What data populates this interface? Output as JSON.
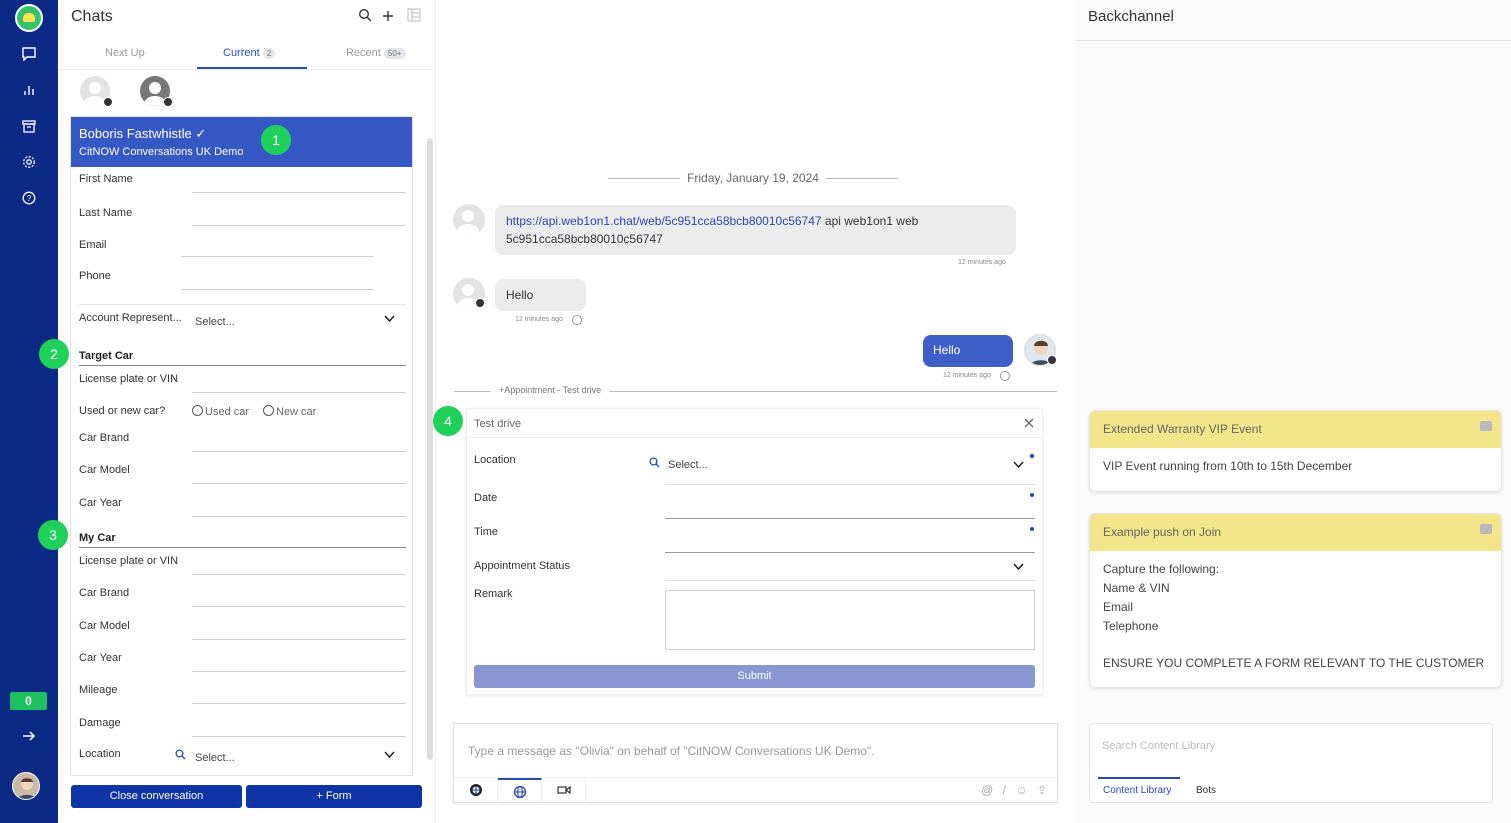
{
  "nav": {
    "unread_badge": "0",
    "icons": [
      "chat-icon",
      "bar-chart-icon",
      "archive-icon",
      "settings-icon",
      "help-icon",
      "arrow-right-icon"
    ]
  },
  "chats": {
    "title": "Chats",
    "tabs": [
      {
        "label": "Next Up",
        "count": ""
      },
      {
        "label": "Current",
        "count": "2"
      },
      {
        "label": "Recent",
        "count": "50+"
      }
    ]
  },
  "contact": {
    "name": "Boboris Fastwhistle",
    "check": "✓",
    "org": "CitNOW Conversations UK Demo",
    "fields": {
      "first_name": "First Name",
      "last_name": "Last Name",
      "email": "Email",
      "phone": "Phone",
      "account_rep": "Account Represent...",
      "account_rep_value": "Select..."
    },
    "target_car": {
      "title": "Target Car",
      "plate": "License plate or VIN",
      "used_or_new": "Used or new car?",
      "used": "Used car",
      "new": "New car",
      "brand": "Car Brand",
      "model": "Car Model",
      "year": "Car Year"
    },
    "my_car": {
      "title": "My Car",
      "plate": "License plate or VIN",
      "brand": "Car Brand",
      "model": "Car Model",
      "year": "Car Year",
      "mileage": "Mileage",
      "damage": "Damage",
      "location": "Location",
      "location_value": "Select..."
    },
    "close_button": "Close conversation",
    "form_button": "+ Form"
  },
  "markers": [
    "1",
    "2",
    "3",
    "4"
  ],
  "conversation": {
    "date": "Friday, January 19, 2024",
    "messages": [
      {
        "link": "https://api.web1on1.chat/web/5c951cca58bcb80010c56747",
        "text_a": " api web1on1 web",
        "text_b": "5c951cca58bcb80010c56747",
        "time": "12 minutes ago"
      },
      {
        "text": "Hello",
        "time": "12 minutes ago"
      },
      {
        "text": "Hello",
        "time": "12 minutes ago"
      }
    ],
    "appointment_divider": "+Appointment - Test drive"
  },
  "appointment_form": {
    "title": "Test drive",
    "location": "Location",
    "location_value": "Select...",
    "date": "Date",
    "time": "Time",
    "status": "Appointment Status",
    "remark": "Remark",
    "submit": "Submit"
  },
  "composer": {
    "placeholder": "Type a message as \"Olivia\"  on behalf of \"CitNOW Conversations UK Demo\"."
  },
  "backchannel": {
    "title": "Backchannel",
    "notes": [
      {
        "title": "Extended Warranty VIP Event",
        "lines": [
          "VIP Event running from 10th to 15th December"
        ]
      },
      {
        "title": "Example push on Join",
        "lines": [
          "Capture the following:",
          "Name & VIN",
          "Email",
          "Telephone",
          "",
          "ENSURE YOU COMPLETE A FORM RELEVANT TO THE CUSTOMER"
        ]
      }
    ],
    "search_placeholder": "Search Content Library",
    "lib_tabs": [
      "Content Library",
      "Bots"
    ]
  }
}
